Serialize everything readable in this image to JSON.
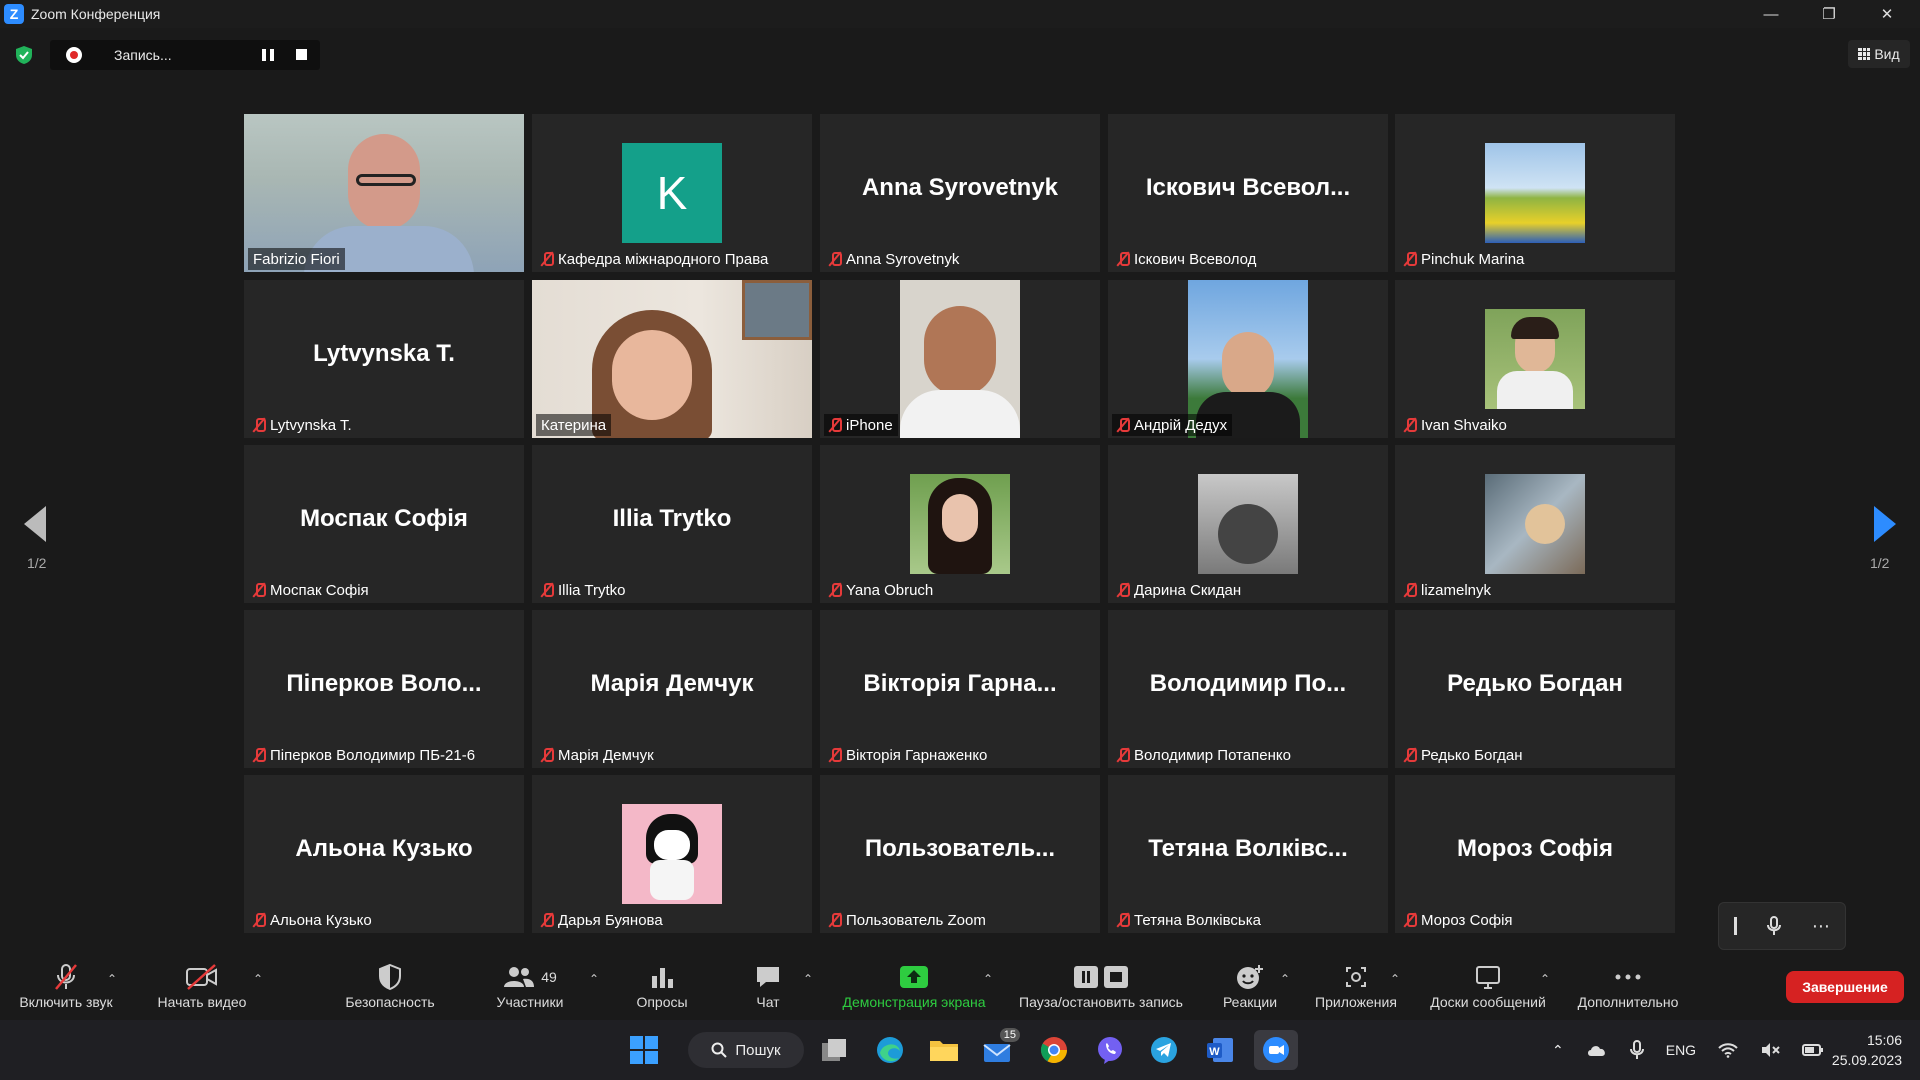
{
  "window": {
    "title": "Zoom Конференция"
  },
  "recording": {
    "status": "Запись..."
  },
  "view_button": "Вид",
  "participants": [
    {
      "big": "",
      "label": "Fabrizio Fiori",
      "muted": false,
      "kind": "video"
    },
    {
      "big": "",
      "label": "Кафедра міжнародного Права",
      "muted": true,
      "kind": "letter",
      "letter": "K"
    },
    {
      "big": "Anna Syrovetnyk",
      "label": "Anna Syrovetnyk",
      "muted": true,
      "kind": "name"
    },
    {
      "big": "Іскович Всевол...",
      "label": "Іскович Всеволод",
      "muted": true,
      "kind": "name"
    },
    {
      "big": "",
      "label": "Pinchuk Marina",
      "muted": true,
      "kind": "avatar"
    },
    {
      "big": "Lytvynska T.",
      "label": "Lytvynska T.",
      "muted": true,
      "kind": "name"
    },
    {
      "big": "",
      "label": "Катерина",
      "muted": false,
      "kind": "video"
    },
    {
      "big": "",
      "label": "iPhone",
      "muted": true,
      "kind": "video"
    },
    {
      "big": "",
      "label": "Андрій Дедух",
      "muted": true,
      "kind": "video"
    },
    {
      "big": "",
      "label": "Ivan Shvaiko",
      "muted": true,
      "kind": "avatar"
    },
    {
      "big": "Моспак Софія",
      "label": "Моспак Софія",
      "muted": true,
      "kind": "name"
    },
    {
      "big": "Illia Trytko",
      "label": "Illia Trytko",
      "muted": true,
      "kind": "name"
    },
    {
      "big": "",
      "label": "Yana Obruch",
      "muted": true,
      "kind": "avatar"
    },
    {
      "big": "",
      "label": "Дарина Скидан",
      "muted": true,
      "kind": "avatar"
    },
    {
      "big": "",
      "label": "lizamelnyk",
      "muted": true,
      "kind": "avatar"
    },
    {
      "big": "Піперков Воло...",
      "label": "Піперков Володимир ПБ-21-6",
      "muted": true,
      "kind": "name"
    },
    {
      "big": "Марія Демчук",
      "label": "Марія Демчук",
      "muted": true,
      "kind": "name"
    },
    {
      "big": "Вікторія Гарна...",
      "label": "Вікторія Гарнаженко",
      "muted": true,
      "kind": "name"
    },
    {
      "big": "Володимир По...",
      "label": "Володимир Потапенко",
      "muted": true,
      "kind": "name"
    },
    {
      "big": "Редько Богдан",
      "label": "Редько Богдан",
      "muted": true,
      "kind": "name"
    },
    {
      "big": "Альона Кузько",
      "label": "Альона Кузько",
      "muted": true,
      "kind": "name"
    },
    {
      "big": "",
      "label": "Дарья Буянова",
      "muted": true,
      "kind": "avatar"
    },
    {
      "big": "Пользователь...",
      "label": "Пользователь Zoom",
      "muted": true,
      "kind": "name"
    },
    {
      "big": "Тетяна Волківс...",
      "label": "Тетяна Волківська",
      "muted": true,
      "kind": "name"
    },
    {
      "big": "Мороз Софія",
      "label": "Мороз Софія",
      "muted": true,
      "kind": "name"
    }
  ],
  "pagination": {
    "left": "1/2",
    "right": "1/2"
  },
  "toolbar": {
    "unmute": "Включить звук",
    "start_video": "Начать видео",
    "security": "Безопасность",
    "participants": "Участники",
    "participants_count": "49",
    "polls": "Опросы",
    "chat": "Чат",
    "share": "Демонстрация экрана",
    "pause_record": "Пауза/остановить запись",
    "reactions": "Реакции",
    "apps": "Приложения",
    "whiteboards": "Доски сообщений",
    "more": "Дополнительно",
    "end": "Завершение"
  },
  "taskbar": {
    "search": "Пошук",
    "mail_badge": "15",
    "lang": "ENG",
    "time": "15:06",
    "date": "25.09.2023"
  },
  "colors": {
    "active_speaker": "#c5e86c",
    "share_green": "#2ecc40",
    "end_red": "#d62222",
    "mute_red": "#e63a3a"
  }
}
